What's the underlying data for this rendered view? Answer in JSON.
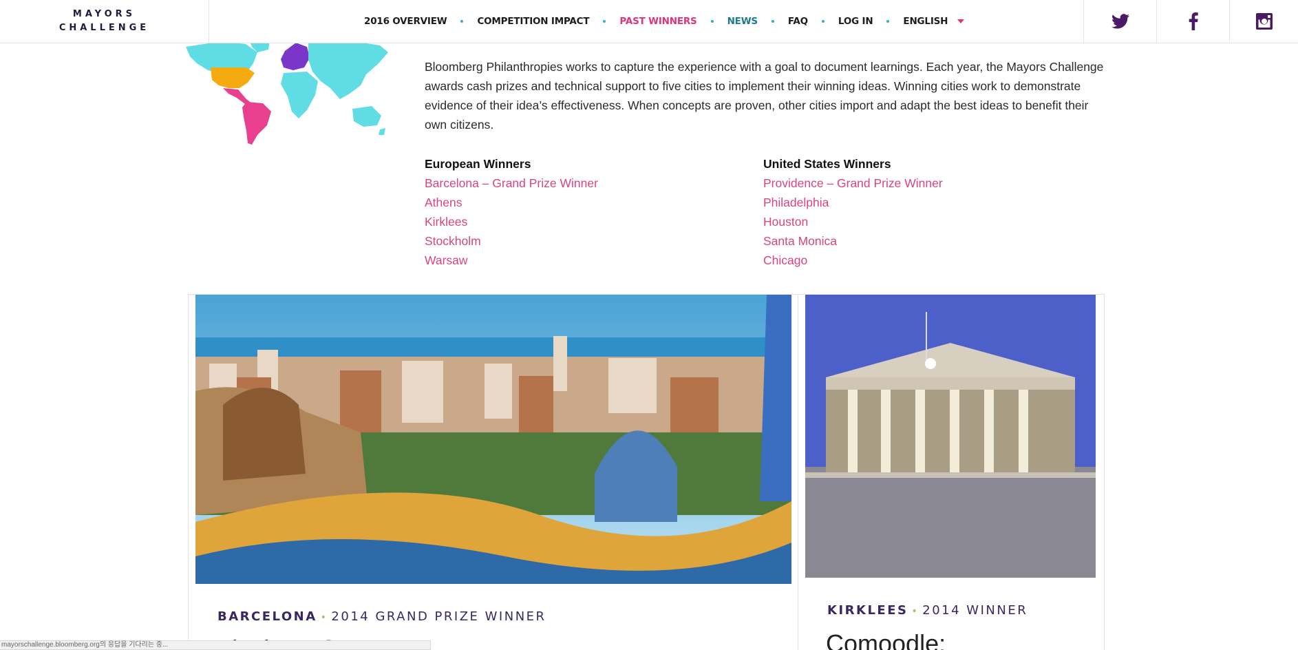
{
  "header": {
    "logo": {
      "line1": "MAYORS",
      "line2": "CHALLENGE"
    },
    "nav": [
      {
        "label": "2016 OVERVIEW",
        "state": "default"
      },
      {
        "label": "COMPETITION IMPACT",
        "state": "default"
      },
      {
        "label": "PAST WINNERS",
        "state": "active"
      },
      {
        "label": "NEWS",
        "state": "teal"
      },
      {
        "label": "FAQ",
        "state": "default"
      },
      {
        "label": "LOG IN",
        "state": "default"
      },
      {
        "label": "ENGLISH",
        "state": "dropdown"
      }
    ],
    "social": [
      {
        "icon": "twitter-icon"
      },
      {
        "icon": "facebook-icon"
      },
      {
        "icon": "instagram-icon"
      }
    ]
  },
  "intro": {
    "text": "Bloomberg Philanthropies works to capture the experience with a goal to document learnings. Each year, the Mayors Challenge awards cash prizes and technical support to five cities to implement their winning ideas. Winning cities work to demonstrate evidence of their idea’s effectiveness. When concepts are proven, other cities import and adapt the best ideas to benefit their own citizens."
  },
  "winners": {
    "europe": {
      "heading": "European Winners",
      "items": [
        "Barcelona – Grand Prize Winner",
        "Athens",
        "Kirklees",
        "Stockholm",
        "Warsaw"
      ]
    },
    "us": {
      "heading": "United States Winners",
      "items": [
        "Providence – Grand Prize Winner",
        "Philadelphia",
        "Houston",
        "Santa Monica",
        "Chicago"
      ]
    }
  },
  "cards": [
    {
      "city": "BARCELONA",
      "award": "2014 GRAND PRIZE WINNER",
      "title": "Vincles BCN"
    },
    {
      "city": "KIRKLEES",
      "award": "2014 WINNER",
      "title": "Comoodle:"
    }
  ],
  "statusbar": {
    "text": "mayorschallenge.bloomberg.org의 응답을 기다리는 중..."
  },
  "colors": {
    "accent": "#e0347a",
    "purple": "#4a1a66",
    "teal": "#2fb0c8",
    "link": "#d9447e"
  }
}
